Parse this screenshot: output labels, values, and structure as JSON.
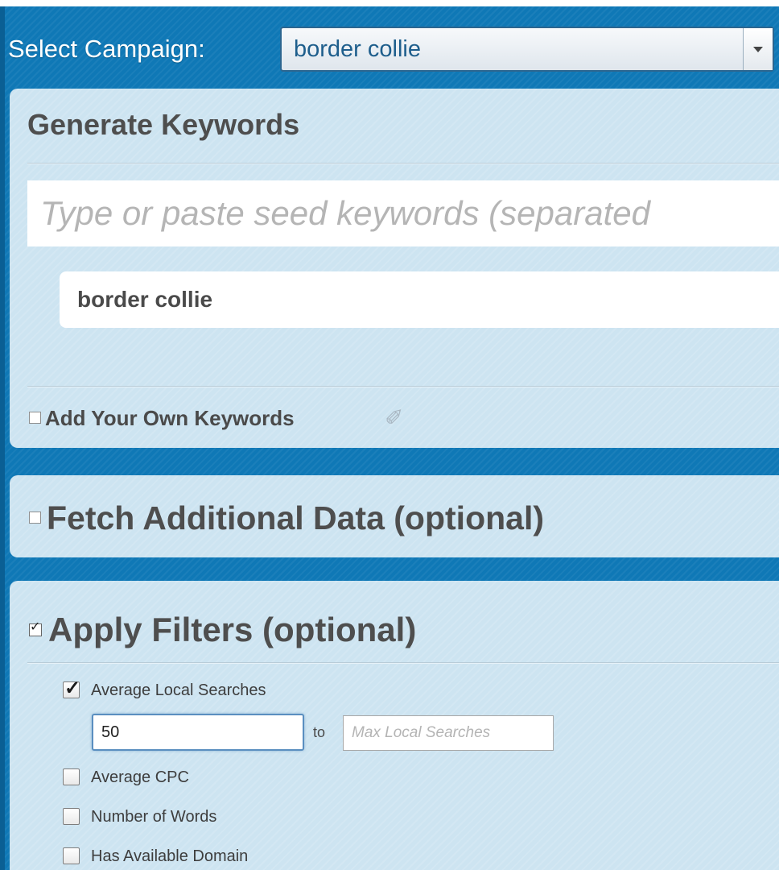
{
  "campaign": {
    "label": "Select Campaign:",
    "selected": "border collie"
  },
  "generate": {
    "title": "Generate Keywords",
    "seed_placeholder": "Type or paste seed keywords (separated",
    "keywords": [
      "border collie"
    ],
    "own_keywords_label": "Add Your Own Keywords",
    "own_keywords_checked": false
  },
  "fetch": {
    "title": "Fetch Additional Data (optional)",
    "checked": false
  },
  "filters": {
    "title": "Apply Filters (optional)",
    "checked": true,
    "items": [
      {
        "label": "Average Local Searches",
        "checked": true
      },
      {
        "label": "Average CPC",
        "checked": false
      },
      {
        "label": "Number of Words",
        "checked": false
      },
      {
        "label": "Has Available Domain",
        "checked": false
      }
    ],
    "min_value": "50",
    "to_label": "to",
    "max_placeholder": "Max Local Searches"
  }
}
